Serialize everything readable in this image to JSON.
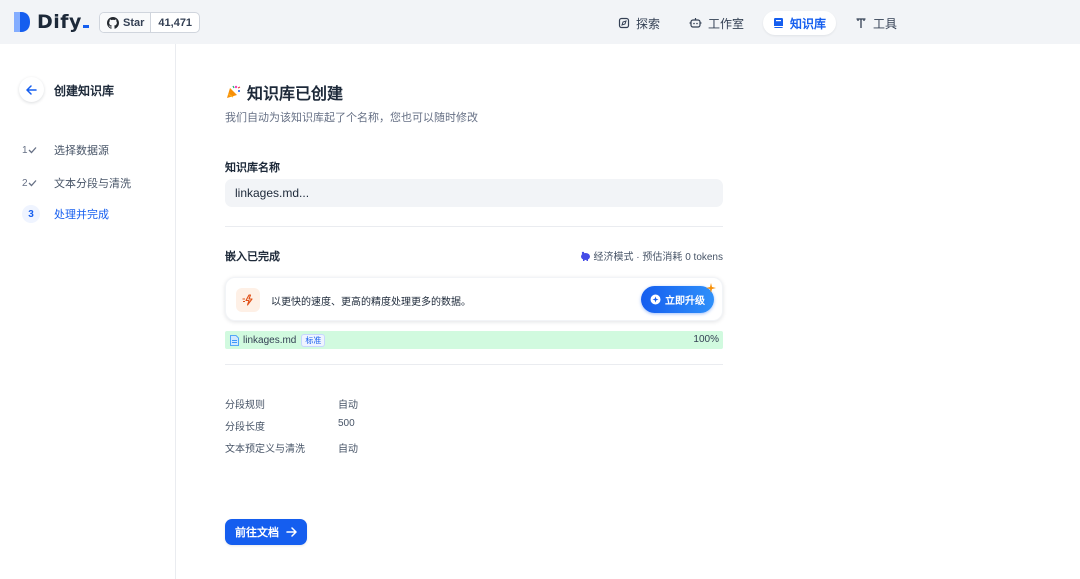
{
  "header": {
    "logo_text": "Dify",
    "github": {
      "star_label": "Star",
      "count": "41,471"
    },
    "nav": [
      {
        "label": "探索",
        "icon": "explore-icon",
        "active": false
      },
      {
        "label": "工作室",
        "icon": "robot-icon",
        "active": false
      },
      {
        "label": "知识库",
        "icon": "book-icon",
        "active": true
      },
      {
        "label": "工具",
        "icon": "tool-icon",
        "active": false
      }
    ]
  },
  "sidebar": {
    "title": "创建知识库",
    "steps": [
      {
        "num": "1",
        "label": "选择数据源",
        "done": true
      },
      {
        "num": "2",
        "label": "文本分段与清洗",
        "done": true
      },
      {
        "num": "3",
        "label": "处理并完成",
        "active": true
      }
    ]
  },
  "main": {
    "title": "知识库已创建",
    "subtitle": "我们自动为该知识库起了个名称，您也可以随时修改",
    "name_label": "知识库名称",
    "name_value": "linkages.md...",
    "embed_title": "嵌入已完成",
    "embed_meta": "经济模式 · 预估消耗 0 tokens",
    "upgrade_text": "以更快的速度、更高的精度处理更多的数据。",
    "upgrade_button": "立即升级",
    "file": {
      "name": "linkages.md",
      "tag": "标准",
      "progress": "100%"
    },
    "rules": [
      {
        "key": "分段规则",
        "value": "自动"
      },
      {
        "key": "分段长度",
        "value": "500"
      },
      {
        "key": "文本预定义与清洗",
        "value": "自动"
      }
    ],
    "go_button": "前往文档"
  },
  "colors": {
    "accent": "#155eef",
    "progress_bg": "#d1fadf",
    "header_bg": "#f2f4f7"
  }
}
